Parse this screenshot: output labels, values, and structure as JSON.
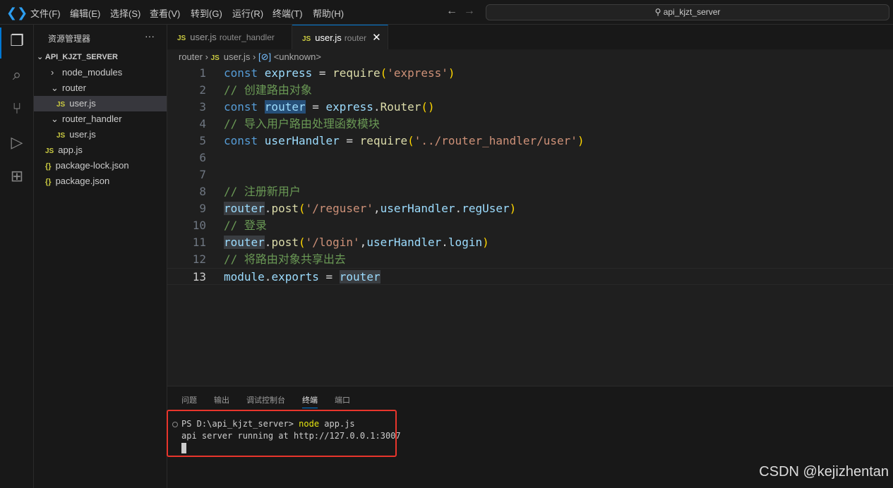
{
  "titlebar": {
    "menu": [
      "文件(F)",
      "编辑(E)",
      "选择(S)",
      "查看(V)",
      "转到(G)",
      "运行(R)",
      "终端(T)",
      "帮助(H)"
    ],
    "search": "api_kjzt_server"
  },
  "sidebar": {
    "title": "资源管理器",
    "more": "···",
    "root": "API_KJZT_SERVER",
    "items": [
      {
        "label": "node_modules",
        "type": "folder",
        "open": false
      },
      {
        "label": "router",
        "type": "folder",
        "open": true
      },
      {
        "label": "user.js",
        "type": "js",
        "selected": true
      },
      {
        "label": "router_handler",
        "type": "folder",
        "open": true
      },
      {
        "label": "user.js",
        "type": "js"
      },
      {
        "label": "app.js",
        "type": "js"
      },
      {
        "label": "package-lock.json",
        "type": "json"
      },
      {
        "label": "package.json",
        "type": "json"
      }
    ]
  },
  "tabs": [
    {
      "label": "user.js",
      "desc": "router_handler",
      "active": false
    },
    {
      "label": "user.js",
      "desc": "router",
      "active": true
    }
  ],
  "breadcrumb": [
    "router",
    "user.js",
    "<unknown>"
  ],
  "code": [
    [
      [
        "kw",
        "const "
      ],
      [
        "var",
        "express"
      ],
      [
        "pl",
        " = "
      ],
      [
        "fn",
        "require"
      ],
      [
        "p",
        "("
      ],
      [
        "str",
        "'express'"
      ],
      [
        "p",
        ")"
      ]
    ],
    [
      [
        "cm",
        "// 创建路由对象"
      ]
    ],
    [
      [
        "kw",
        "const "
      ],
      [
        "var hl2",
        "router"
      ],
      [
        "pl",
        " = "
      ],
      [
        "var",
        "express"
      ],
      [
        "pl",
        "."
      ],
      [
        "fn",
        "Router"
      ],
      [
        "p",
        "()"
      ]
    ],
    [
      [
        "cm",
        "// 导入用户路由处理函数模块"
      ]
    ],
    [
      [
        "kw",
        "const "
      ],
      [
        "var",
        "userHandler"
      ],
      [
        "pl",
        " = "
      ],
      [
        "fn",
        "require"
      ],
      [
        "p",
        "("
      ],
      [
        "str",
        "'../router_handler/user'"
      ],
      [
        "p",
        ")"
      ]
    ],
    [],
    [],
    [
      [
        "cm",
        "// 注册新用户"
      ]
    ],
    [
      [
        "var hl",
        "router"
      ],
      [
        "pl",
        "."
      ],
      [
        "fn",
        "post"
      ],
      [
        "p",
        "("
      ],
      [
        "str",
        "'/reguser'"
      ],
      [
        "pl",
        ","
      ],
      [
        "var",
        "userHandler"
      ],
      [
        "pl",
        "."
      ],
      [
        "var",
        "regUser"
      ],
      [
        "p",
        ")"
      ]
    ],
    [
      [
        "cm",
        "// 登录"
      ]
    ],
    [
      [
        "var hl",
        "router"
      ],
      [
        "pl",
        "."
      ],
      [
        "fn",
        "post"
      ],
      [
        "p",
        "("
      ],
      [
        "str",
        "'/login'"
      ],
      [
        "pl",
        ","
      ],
      [
        "var",
        "userHandler"
      ],
      [
        "pl",
        "."
      ],
      [
        "var",
        "login"
      ],
      [
        "p",
        ")"
      ]
    ],
    [
      [
        "cm",
        "// 将路由对象共享出去"
      ]
    ],
    [
      [
        "var",
        "module"
      ],
      [
        "pl",
        "."
      ],
      [
        "var",
        "exports"
      ],
      [
        "pl",
        " = "
      ],
      [
        "var hl",
        "router"
      ]
    ]
  ],
  "panel": {
    "tabs": [
      "问题",
      "输出",
      "调试控制台",
      "终端",
      "端口"
    ],
    "active": 3,
    "prompt": "PS D:\\api_kjzt_server> ",
    "cmd": "node",
    "args": " app.js",
    "output": "api server running at http://127.0.0.1:3007"
  },
  "watermark": "CSDN @kejizhentan"
}
